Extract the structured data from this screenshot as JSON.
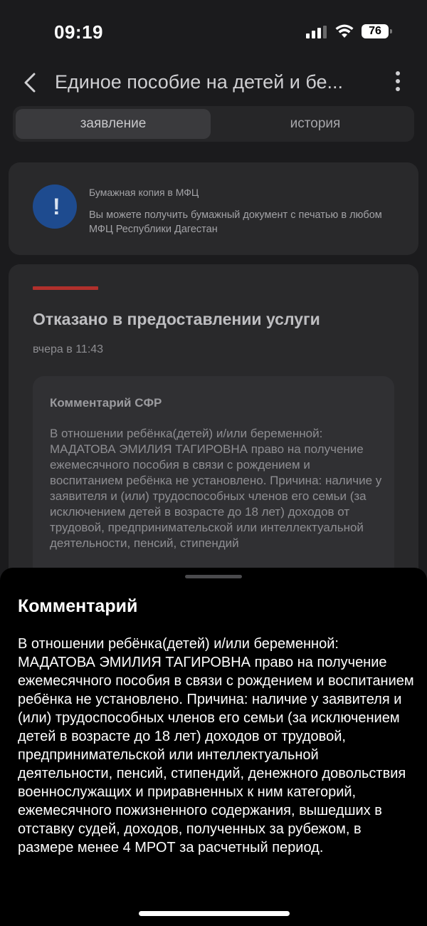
{
  "status_bar": {
    "time": "09:19",
    "battery": "76"
  },
  "header": {
    "title": "Единое пособие на детей и бе..."
  },
  "tabs": [
    {
      "label": "заявление",
      "active": true
    },
    {
      "label": "история",
      "active": false
    }
  ],
  "info_card": {
    "icon": "exclamation-icon",
    "title": "Бумажная копия в МФЦ",
    "text": "Вы можете получить бумажный документ с печатью в любом МФЦ Республики Дагестан"
  },
  "status_card": {
    "accent_color": "#b1302c",
    "title": "Отказано в предоставлении услуги",
    "time": "вчера в 11:43",
    "comment_title": "Комментарий СФР",
    "comment_text": "В отношении ребёнка(детей) и/или беременной: МАДАТОВА ЭМИЛИЯ ТАГИРОВНА право на получение ежемесячного пособия в связи с рождением и воспитанием ребёнка не установлено. Причина: наличие у заявителя и (или) трудоспособных членов его семьи (за исключением детей в возрасте до 18 лет) доходов от трудовой, предпринимательской или интеллектуальной деятельности, пенсий, стипендий"
  },
  "sheet": {
    "title": "Комментарий",
    "text": "В отношении ребёнка(детей) и/или беременной: МАДАТОВА ЭМИЛИЯ ТАГИРОВНА право на получение ежемесячного пособия в связи с рождением и воспитанием ребёнка не установлено. Причина: наличие у заявителя и (или) трудоспособных членов его семьи (за исключением детей в возрасте до 18 лет) доходов от трудовой, предпринимательской или интеллектуальной деятельности, пенсий, стипендий, денежного довольствия военнослужащих и приравненных к ним категорий, ежемесячного пожизненного содержания, вышедших в отставку судей, доходов, полученных за рубежом, в размере менее 4 МРОТ за расчетный период."
  }
}
